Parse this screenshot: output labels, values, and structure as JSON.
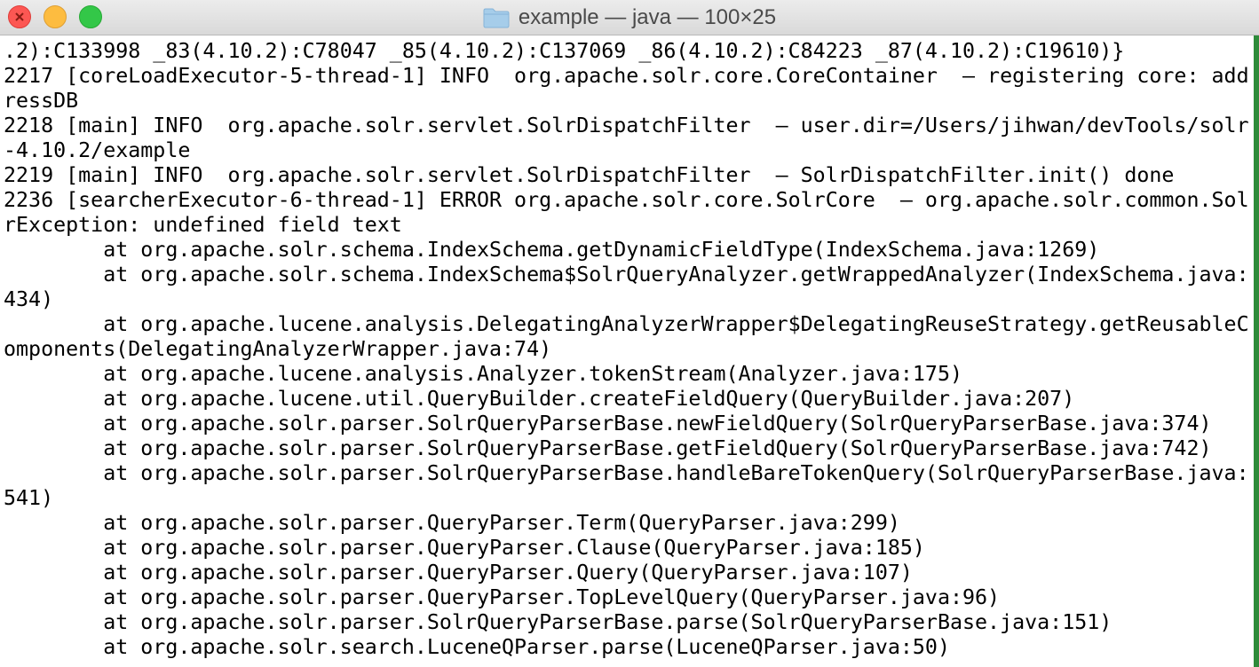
{
  "window": {
    "title": "example — java — 100×25",
    "controls": {
      "close_icon": "close-icon",
      "minimize_icon": "minimize-icon",
      "zoom_icon": "zoom-icon"
    },
    "folder_icon": "folder-icon"
  },
  "terminal": {
    "lines": [
      ".2):C133998 _83(4.10.2):C78047 _85(4.10.2):C137069 _86(4.10.2):C84223 _87(4.10.2):C19610)}",
      "2217 [coreLoadExecutor-5-thread-1] INFO  org.apache.solr.core.CoreContainer  – registering core: add",
      "ressDB",
      "2218 [main] INFO  org.apache.solr.servlet.SolrDispatchFilter  – user.dir=/Users/jihwan/devTools/solr",
      "-4.10.2/example",
      "2219 [main] INFO  org.apache.solr.servlet.SolrDispatchFilter  – SolrDispatchFilter.init() done",
      "2236 [searcherExecutor-6-thread-1] ERROR org.apache.solr.core.SolrCore  – org.apache.solr.common.Sol",
      "rException: undefined field text",
      "        at org.apache.solr.schema.IndexSchema.getDynamicFieldType(IndexSchema.java:1269)",
      "        at org.apache.solr.schema.IndexSchema$SolrQueryAnalyzer.getWrappedAnalyzer(IndexSchema.java:",
      "434)",
      "        at org.apache.lucene.analysis.DelegatingAnalyzerWrapper$DelegatingReuseStrategy.getReusableC",
      "omponents(DelegatingAnalyzerWrapper.java:74)",
      "        at org.apache.lucene.analysis.Analyzer.tokenStream(Analyzer.java:175)",
      "        at org.apache.lucene.util.QueryBuilder.createFieldQuery(QueryBuilder.java:207)",
      "        at org.apache.solr.parser.SolrQueryParserBase.newFieldQuery(SolrQueryParserBase.java:374)",
      "        at org.apache.solr.parser.SolrQueryParserBase.getFieldQuery(SolrQueryParserBase.java:742)",
      "        at org.apache.solr.parser.SolrQueryParserBase.handleBareTokenQuery(SolrQueryParserBase.java:",
      "541)",
      "        at org.apache.solr.parser.QueryParser.Term(QueryParser.java:299)",
      "        at org.apache.solr.parser.QueryParser.Clause(QueryParser.java:185)",
      "        at org.apache.solr.parser.QueryParser.Query(QueryParser.java:107)",
      "        at org.apache.solr.parser.QueryParser.TopLevelQuery(QueryParser.java:96)",
      "        at org.apache.solr.parser.SolrQueryParserBase.parse(SolrQueryParserBase.java:151)",
      "        at org.apache.solr.search.LuceneQParser.parse(LuceneQParser.java:50)"
    ]
  }
}
